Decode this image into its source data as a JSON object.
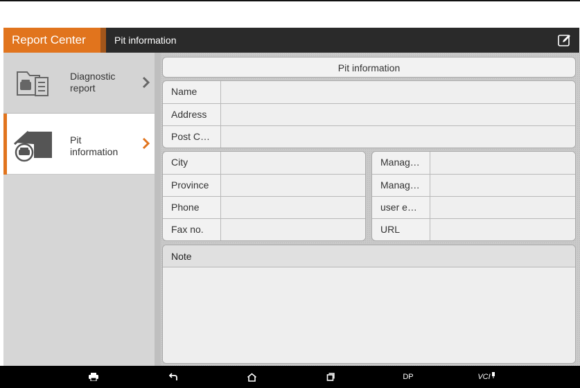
{
  "header": {
    "app_title": "Report Center",
    "page_title": "Pit information",
    "edit_icon": "edit-icon"
  },
  "sidebar": {
    "items": [
      {
        "label": "Diagnostic\nreport",
        "icon": "car-document-icon",
        "active": false
      },
      {
        "label": "Pit\ninformation",
        "icon": "garage-car-icon",
        "active": true
      }
    ]
  },
  "form": {
    "title": "Pit information",
    "top_fields": [
      {
        "label": "Name",
        "value": ""
      },
      {
        "label": "Address",
        "value": ""
      },
      {
        "label": "Post C…",
        "value": ""
      }
    ],
    "left_fields": [
      {
        "label": "City",
        "value": ""
      },
      {
        "label": "Province",
        "value": ""
      },
      {
        "label": "Phone",
        "value": ""
      },
      {
        "label": "Fax no.",
        "value": ""
      }
    ],
    "right_fields": [
      {
        "label": "Manag…",
        "value": ""
      },
      {
        "label": "Manag…",
        "value": ""
      },
      {
        "label": "user e…",
        "value": ""
      },
      {
        "label": "URL",
        "value": ""
      }
    ],
    "note_label": "Note",
    "note_value": ""
  },
  "navbar": {
    "dp_label": "DP",
    "vci_label": "VCI"
  },
  "colors": {
    "accent": "#e1741d",
    "header_bg": "#2a2a2a",
    "sidebar_bg": "#d6d6d6"
  }
}
